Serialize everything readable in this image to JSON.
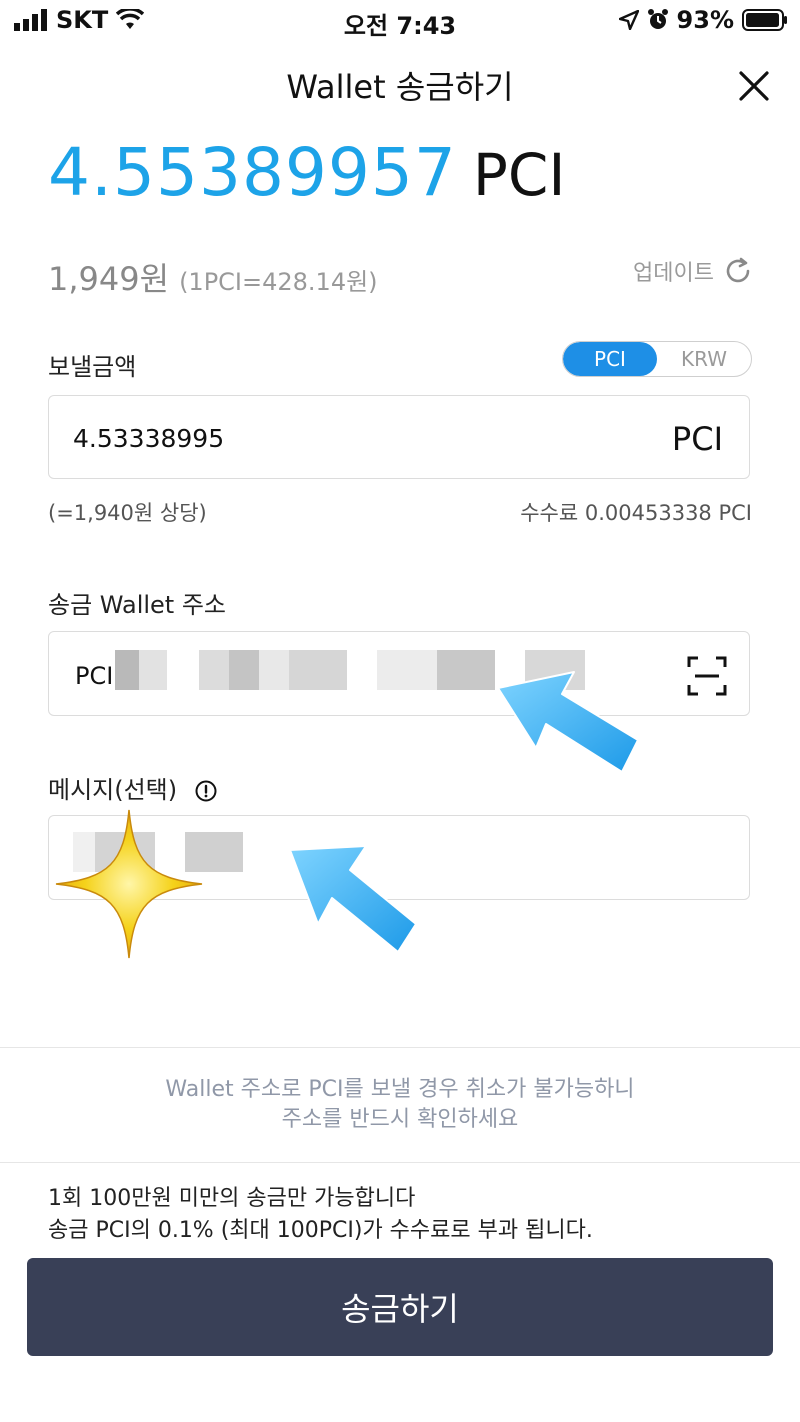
{
  "status_bar": {
    "carrier": "SKT",
    "time": "오전 7:43",
    "battery": "93%"
  },
  "header": {
    "title": "Wallet 송금하기"
  },
  "balance": {
    "amount": "4.55389957",
    "unit": "PCI",
    "fiat": "1,949원",
    "rate": "(1PCI=428.14원)",
    "update_label": "업데이트"
  },
  "amount_section": {
    "label": "보낼금액",
    "toggle_options": [
      "PCI",
      "KRW"
    ],
    "selected": "PCI",
    "value": "4.53338995",
    "unit": "PCI",
    "fiat_equivalent": "(=1,940원 상당)",
    "fee": "수수료 0.00453338 PCI"
  },
  "address_section": {
    "label": "송금 Wallet 주소",
    "prefix": "PCI"
  },
  "message_section": {
    "label": "메시지(선택)"
  },
  "warning": {
    "line1": "Wallet 주소로 PCI를 보낼 경우 취소가 불가능하니",
    "line2": "주소를 반드시 확인하세요"
  },
  "notice": {
    "line1": "1회 100만원 미만의 송금만 가능합니다",
    "line2": "송금 PCI의 0.1% (최대 100PCI)가 수수료로 부과 됩니다."
  },
  "submit_label": "송금하기",
  "colors": {
    "accent": "#1da3e8",
    "toggle_active": "#1e8fe6",
    "button": "#394057",
    "arrow": "#3cb4f2",
    "sparkle": "#f5d21a"
  }
}
